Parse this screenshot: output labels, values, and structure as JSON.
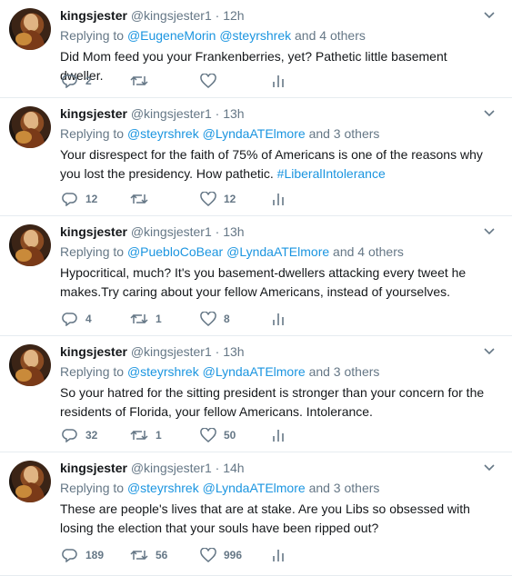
{
  "colors": {
    "link": "#1b95e0",
    "muted": "#657786",
    "text": "#14171a",
    "divider": "#e6ecf0"
  },
  "tweets": [
    {
      "name": "kingsjester",
      "handle": "@kingsjester1",
      "dot": "·",
      "time": "12h",
      "replying_prefix": "Replying to",
      "replying_users": [
        "@EugeneMorin",
        "@steyrshrek"
      ],
      "replying_suffix": "and 4 others",
      "text": "Did Mom feed you your Frankenberries, yet? Pathetic little basement dweller.",
      "hashtag": "",
      "replies": "2",
      "retweets": "",
      "likes": ""
    },
    {
      "name": "kingsjester",
      "handle": "@kingsjester1",
      "dot": "·",
      "time": "13h",
      "replying_prefix": "Replying to",
      "replying_users": [
        "@steyrshrek",
        "@LyndaATElmore"
      ],
      "replying_suffix": "and 3 others",
      "text": "Your disrespect for the faith of 75% of Americans is one of the reasons why you lost the presidency. How pathetic. ",
      "hashtag": "#LiberalIntolerance",
      "replies": "12",
      "retweets": "",
      "likes": "12"
    },
    {
      "name": "kingsjester",
      "handle": "@kingsjester1",
      "dot": "·",
      "time": "13h",
      "replying_prefix": "Replying to",
      "replying_users": [
        "@PuebloCoBear",
        "@LyndaATElmore"
      ],
      "replying_suffix": "and 4 others",
      "text": "Hypocritical, much? It's you basement-dwellers attacking every tweet he makes.Try caring about your fellow Americans, instead of yourselves.",
      "hashtag": "",
      "replies": "4",
      "retweets": "1",
      "likes": "8"
    },
    {
      "name": "kingsjester",
      "handle": "@kingsjester1",
      "dot": "·",
      "time": "13h",
      "replying_prefix": "Replying to",
      "replying_users": [
        "@steyrshrek",
        "@LyndaATElmore"
      ],
      "replying_suffix": "and 3 others",
      "text": "So your hatred for the sitting president is stronger than your concern for the residents of Florida, your fellow Americans. Intolerance.",
      "hashtag": "",
      "replies": "32",
      "retweets": "1",
      "likes": "50"
    },
    {
      "name": "kingsjester",
      "handle": "@kingsjester1",
      "dot": "·",
      "time": "14h",
      "replying_prefix": "Replying to",
      "replying_users": [
        "@steyrshrek",
        "@LyndaATElmore"
      ],
      "replying_suffix": "and 3 others",
      "text": "These are people's lives that are at stake. Are you Libs so obsessed with losing the election  that your souls have been ripped out?",
      "hashtag": "",
      "replies": "189",
      "retweets": "56",
      "likes": "996"
    }
  ],
  "icons": {
    "reply": "reply-icon",
    "retweet": "retweet-icon",
    "like": "heart-icon",
    "stats": "analytics-icon",
    "caret": "chevron-down-icon"
  }
}
